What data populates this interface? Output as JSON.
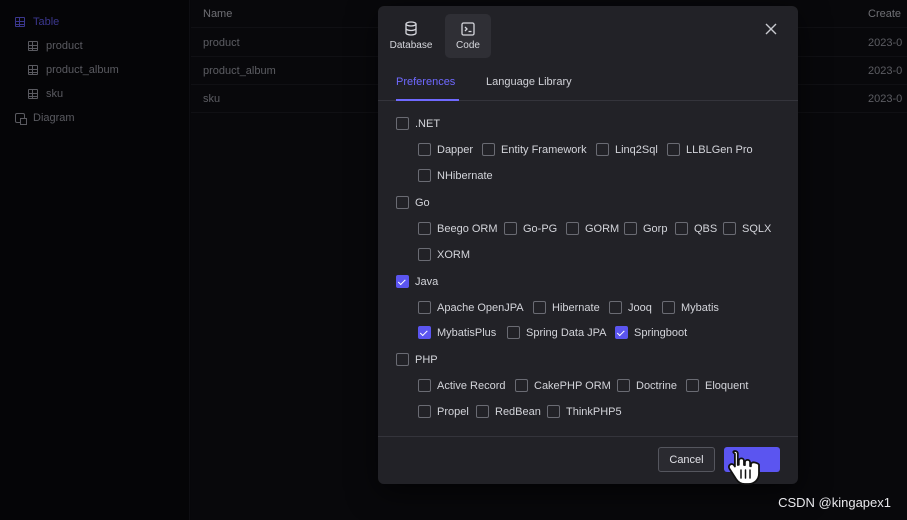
{
  "sidebar": {
    "items": [
      {
        "label": "Table"
      },
      {
        "label": "product"
      },
      {
        "label": "product_album"
      },
      {
        "label": "sku"
      },
      {
        "label": "Diagram"
      }
    ]
  },
  "grid": {
    "headers": {
      "name": "Name",
      "create": "Create"
    },
    "rows": [
      {
        "name": "product",
        "create": "2023-0"
      },
      {
        "name": "product_album",
        "create": "2023-0"
      },
      {
        "name": "sku",
        "create": "2023-0"
      }
    ]
  },
  "modal": {
    "type_tabs": [
      {
        "label": "Database",
        "icon": "database-icon"
      },
      {
        "label": "Code",
        "icon": "terminal-icon"
      }
    ],
    "subtabs": [
      {
        "label": "Preferences"
      },
      {
        "label": "Language Library"
      }
    ],
    "groups": [
      {
        "label": ".NET",
        "checked": false,
        "options": [
          {
            "label": "Dapper",
            "checked": false
          },
          {
            "label": "Entity Framework",
            "checked": false
          },
          {
            "label": "Linq2Sql",
            "checked": false
          },
          {
            "label": "LLBLGen Pro",
            "checked": false
          },
          {
            "label": "NHibernate",
            "checked": false
          }
        ]
      },
      {
        "label": "Go",
        "checked": false,
        "options": [
          {
            "label": "Beego ORM",
            "checked": false
          },
          {
            "label": "Go-PG",
            "checked": false
          },
          {
            "label": "GORM",
            "checked": false
          },
          {
            "label": "Gorp",
            "checked": false
          },
          {
            "label": "QBS",
            "checked": false
          },
          {
            "label": "SQLX",
            "checked": false
          },
          {
            "label": "XORM",
            "checked": false
          }
        ]
      },
      {
        "label": "Java",
        "checked": true,
        "options": [
          {
            "label": "Apache OpenJPA",
            "checked": false
          },
          {
            "label": "Hibernate",
            "checked": false
          },
          {
            "label": "Jooq",
            "checked": false
          },
          {
            "label": "Mybatis",
            "checked": false
          },
          {
            "label": "MybatisPlus",
            "checked": true
          },
          {
            "label": "Spring Data JPA",
            "checked": false
          },
          {
            "label": "Springboot",
            "checked": true
          }
        ]
      },
      {
        "label": "PHP",
        "checked": false,
        "options": [
          {
            "label": "Active Record",
            "checked": false
          },
          {
            "label": "CakePHP ORM",
            "checked": false
          },
          {
            "label": "Doctrine",
            "checked": false
          },
          {
            "label": "Eloquent",
            "checked": false
          },
          {
            "label": "Propel",
            "checked": false
          },
          {
            "label": "RedBean",
            "checked": false
          },
          {
            "label": "ThinkPHP5",
            "checked": false
          }
        ]
      }
    ],
    "footer": {
      "cancel_label": "Cancel",
      "ok_label": ""
    }
  },
  "watermark": "CSDN @kingapex1",
  "colors": {
    "accent": "#5b55f0",
    "modal_bg": "#222227",
    "page_bg": "#0c0c10"
  }
}
